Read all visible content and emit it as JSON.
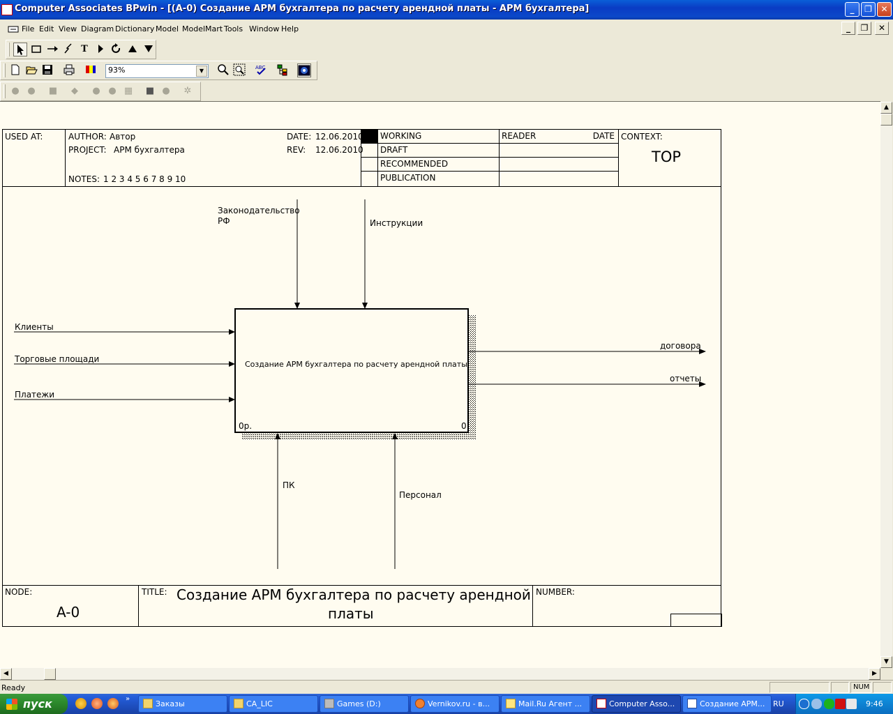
{
  "window": {
    "title": "Computer Associates BPwin - [(A-0) Создание АРМ бухгалтера по расчету арендной платы - АРМ бухгалтера]",
    "min_glyph": "_",
    "max_glyph": "❐",
    "close_glyph": "✕"
  },
  "menu": {
    "items": [
      "File",
      "Edit",
      "View",
      "Diagram",
      "Dictionary",
      "Model",
      "ModelMart",
      "Tools",
      "Window",
      "Help"
    ]
  },
  "toolbar": {
    "zoom_value": "93%"
  },
  "diagram": {
    "header": {
      "used_at_label": "USED AT:",
      "author_label": "AUTHOR:",
      "author_value": "Автор",
      "project_label": "PROJECT:",
      "project_value": "АРМ бухгалтера",
      "date_label": "DATE:",
      "date_value": "12.06.2010",
      "rev_label": "REV:",
      "rev_value": "12.06.2010",
      "notes_label": "NOTES:",
      "notes_value": "1  2  3  4  5  6  7  8  9  10",
      "status_items": [
        "WORKING",
        "DRAFT",
        "RECOMMENDED",
        "PUBLICATION"
      ],
      "reader_label": "READER",
      "reader_date_label": "DATE",
      "context_label": "CONTEXT:",
      "context_value": "TOP"
    },
    "activity": {
      "name": "Создание АРМ бухгалтера по расчету арендной платы",
      "cost": "0р.",
      "number": "0"
    },
    "controls": [
      {
        "label_line1": "Законодательство",
        "label_line2": "РФ"
      },
      {
        "label_line1": "Инструкции",
        "label_line2": ""
      }
    ],
    "inputs": [
      "Клиенты",
      "Торговые площади",
      "Платежи"
    ],
    "outputs": [
      "договора",
      "отчеты"
    ],
    "mechanisms": [
      "ПК",
      "Персонал"
    ],
    "footer": {
      "node_label": "NODE:",
      "node_value": "A-0",
      "title_label": "TITLE:",
      "title_line1": "Создание АРМ бухгалтера по расчету арендной",
      "title_line2": "платы",
      "number_label": "NUMBER:"
    }
  },
  "status": {
    "text": "Ready",
    "num": "NUM"
  },
  "taskbar": {
    "start_label": "пуск",
    "tasks": [
      "Заказы",
      "CA_LIC",
      "Games (D:)",
      "Vernikov.ru - в...",
      "Mail.Ru Агент ...",
      "Computer Asso...",
      "Создание АРМ..."
    ],
    "lang": "RU",
    "clock": "9:46"
  }
}
